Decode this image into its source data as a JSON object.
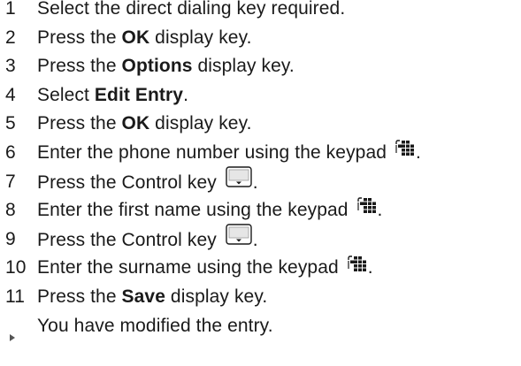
{
  "steps": [
    {
      "number": "1",
      "parts": [
        "Select the direct dialing key required."
      ]
    },
    {
      "number": "2",
      "parts": [
        "Press the ",
        "OK",
        " display key."
      ]
    },
    {
      "number": "3",
      "parts": [
        "Press the ",
        "Options",
        " display key."
      ]
    },
    {
      "number": "4",
      "parts": [
        "Select ",
        "Edit Entry",
        "."
      ]
    },
    {
      "number": "5",
      "parts": [
        "Press the ",
        "OK",
        " display key."
      ]
    },
    {
      "number": "6",
      "parts": [
        "Enter the phone number using the keypad ",
        "."
      ],
      "icon": "keypad-icon"
    },
    {
      "number": "7",
      "parts": [
        "Press the Control key ",
        "."
      ],
      "icon": "control-key-icon"
    },
    {
      "number": "8",
      "parts": [
        "Enter the first name using the keypad ",
        "."
      ],
      "icon": "keypad-icon"
    },
    {
      "number": "9",
      "parts": [
        "Press the Control key ",
        "."
      ],
      "icon": "control-key-icon"
    },
    {
      "number": "10",
      "parts": [
        "Enter the surname using the keypad ",
        "."
      ],
      "icon": "keypad-icon"
    },
    {
      "number": "11",
      "parts": [
        "Press the ",
        "Save",
        " display key."
      ]
    }
  ],
  "result": {
    "icon": "result-arrow-icon",
    "text": "You have modified the entry."
  }
}
